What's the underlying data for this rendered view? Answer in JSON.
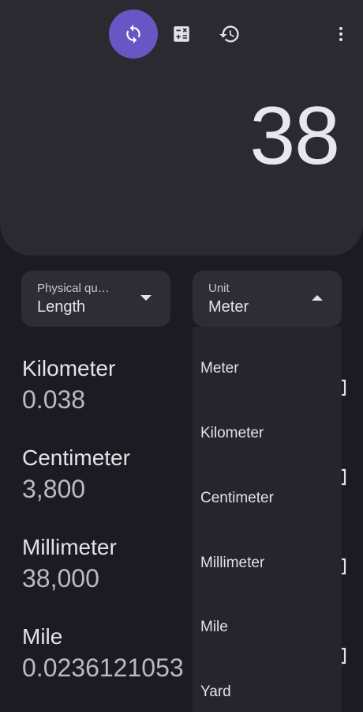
{
  "toolbar": {
    "buttons": [
      {
        "icon": "swap-icon",
        "active": true
      },
      {
        "icon": "calculator-icon",
        "active": false
      },
      {
        "icon": "history-icon",
        "active": false
      },
      {
        "icon": "more-vert-icon",
        "active": false
      }
    ]
  },
  "display": {
    "value": "38"
  },
  "quantity_select": {
    "label": "Physical qu…",
    "value": "Length"
  },
  "unit_select": {
    "label": "Unit",
    "value": "Meter"
  },
  "results": [
    {
      "name": "Kilometer",
      "value": "0.038"
    },
    {
      "name": "Centimeter",
      "value": "3,800"
    },
    {
      "name": "Millimeter",
      "value": "38,000"
    },
    {
      "name": "Mile",
      "value": "0.0236121053"
    }
  ],
  "dropdown": {
    "options": [
      "Meter",
      "Kilometer",
      "Centimeter",
      "Millimeter",
      "Mile",
      "Yard"
    ]
  },
  "colors": {
    "accent": "#6a55c4",
    "panel": "#2b2a31",
    "background": "#1c1b21"
  }
}
